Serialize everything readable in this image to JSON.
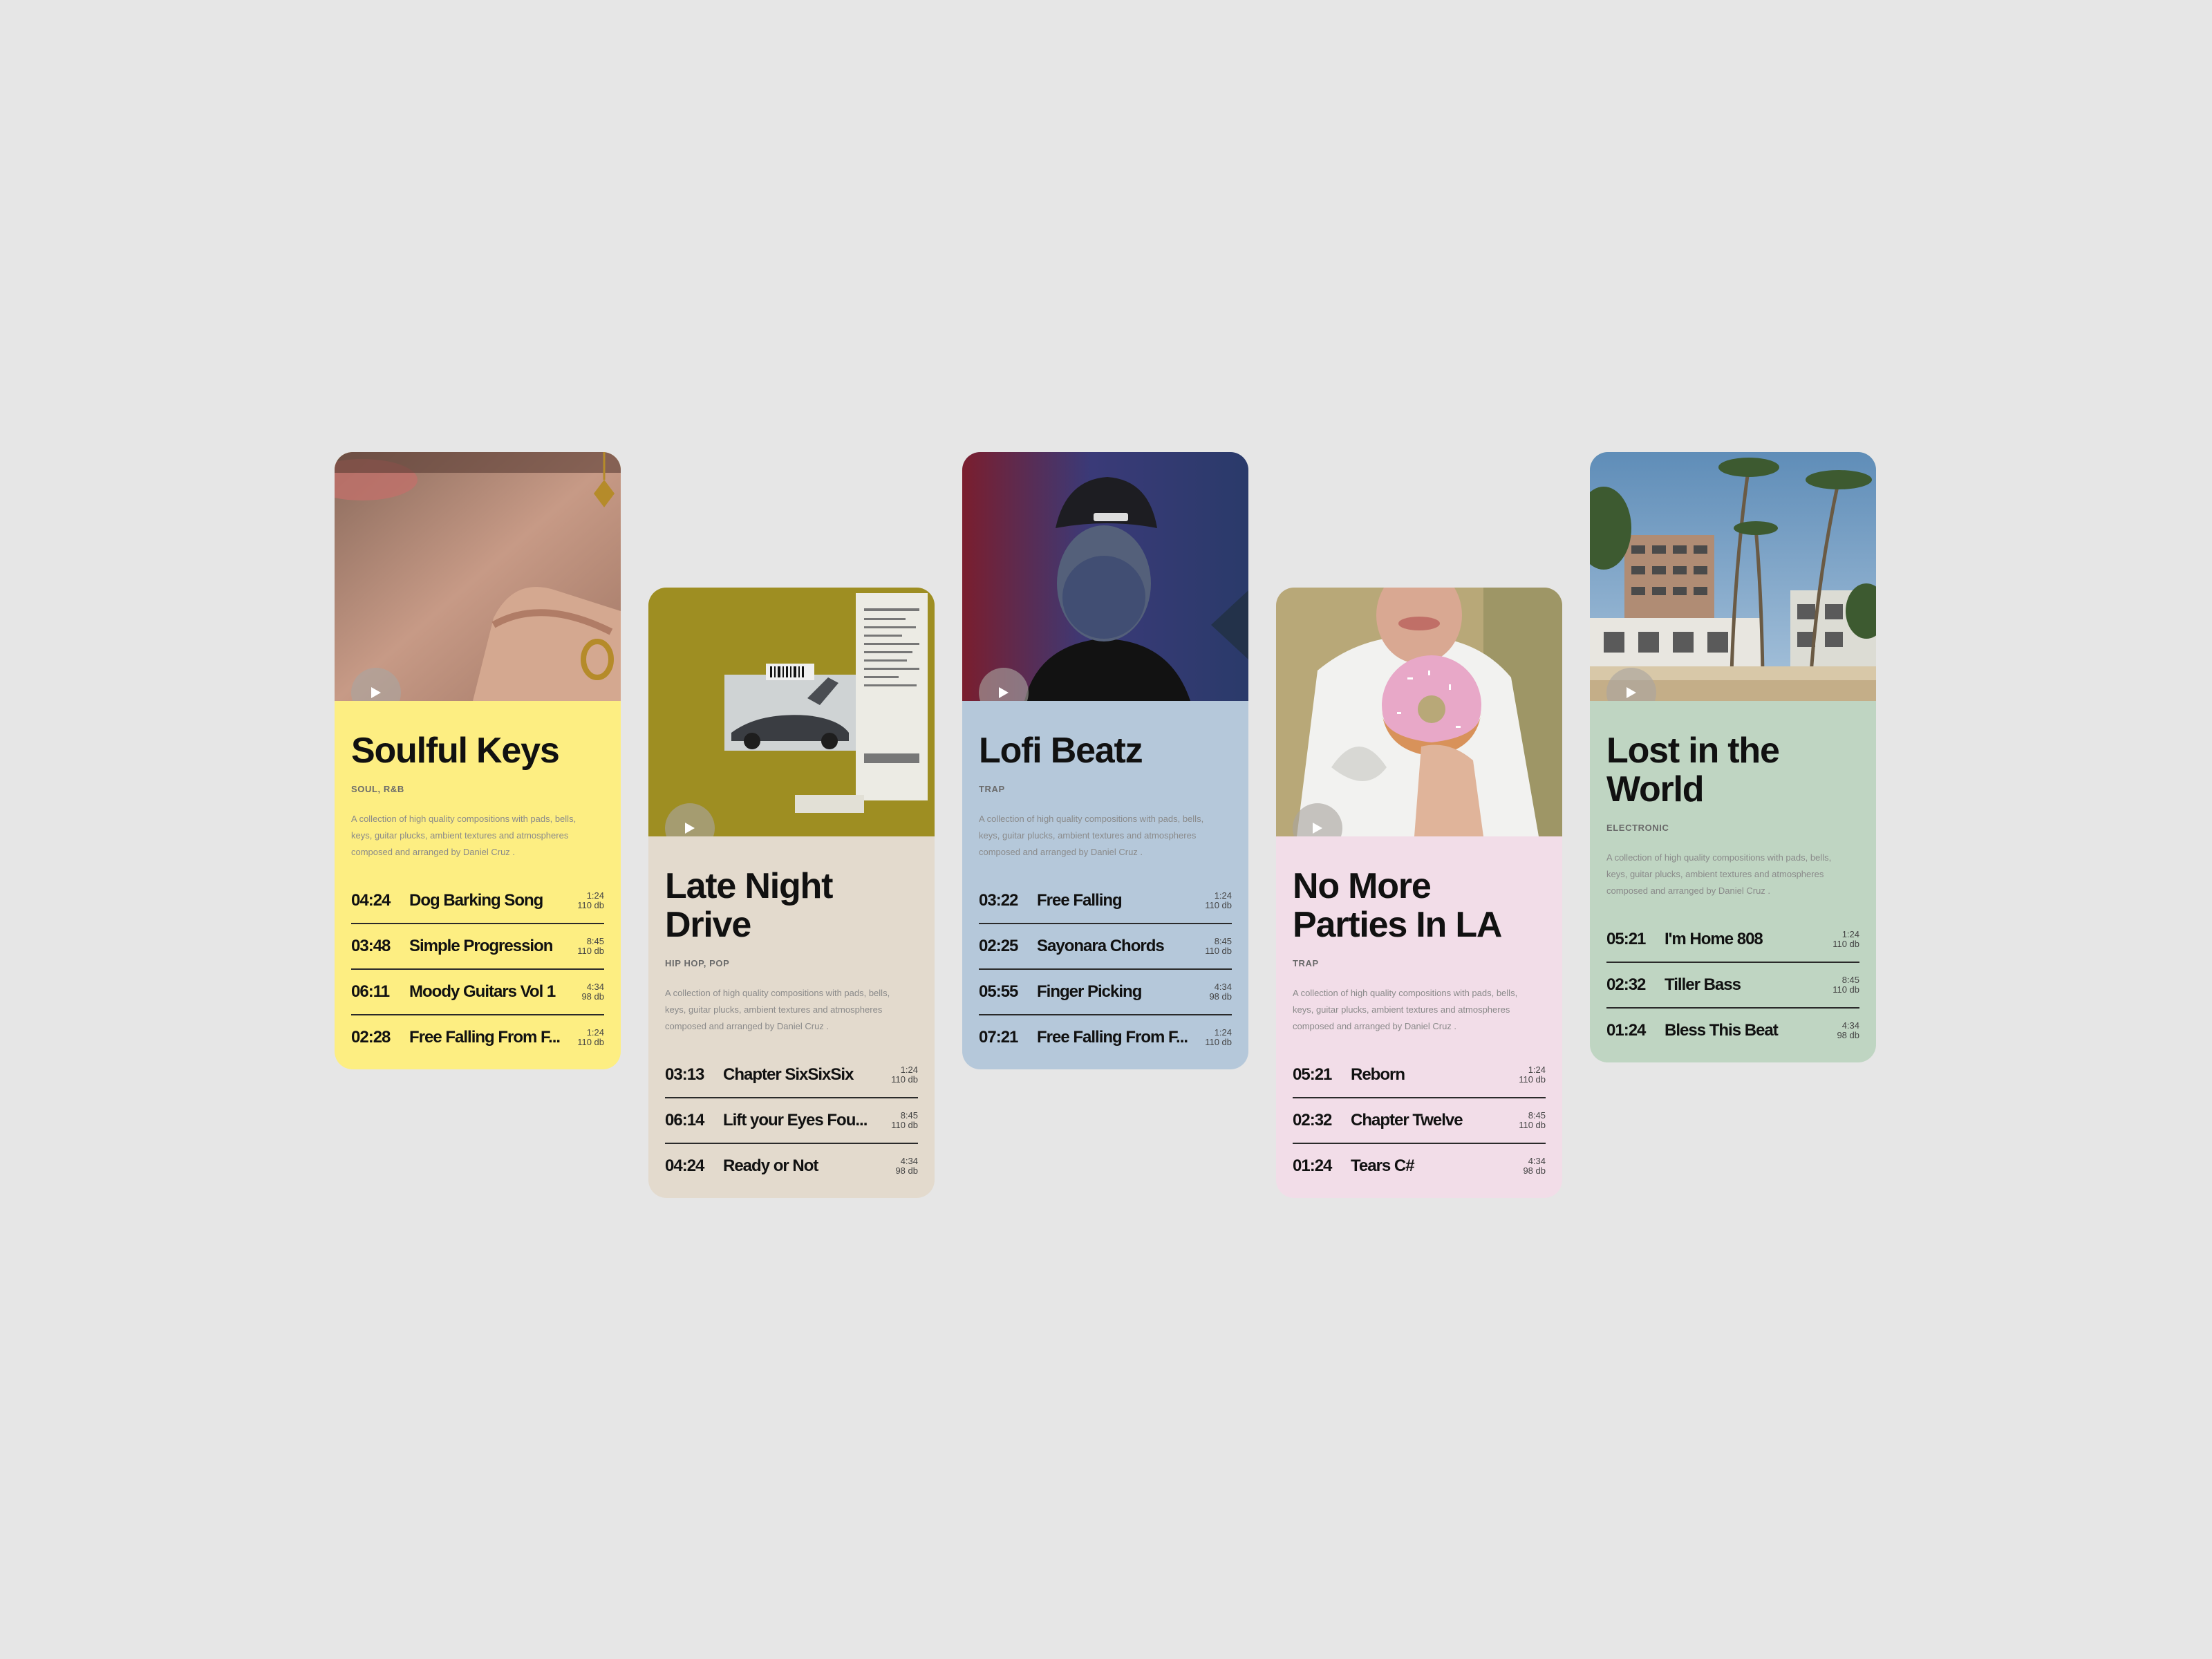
{
  "description_label": "A collection of high quality compositions with pads, bells, keys, guitar plucks, ambient textures and atmospheres composed and arranged by Daniel Cruz",
  "cards": [
    {
      "title": "Soulful Keys",
      "genre": "SOUL, R&B",
      "description": "A collection of high quality compositions with pads, bells, keys, guitar plucks, ambient textures and atmospheres composed and arranged by Daniel Cruz .",
      "color": "#fdee82",
      "tracks": [
        {
          "time": "04:24",
          "name": "Dog Barking Song",
          "dur": "1:24",
          "db": "110 db"
        },
        {
          "time": "03:48",
          "name": "Simple Progression",
          "dur": "8:45",
          "db": "110 db"
        },
        {
          "time": "06:11",
          "name": "Moody Guitars Vol 1",
          "dur": "4:34",
          "db": "98 db"
        },
        {
          "time": "02:28",
          "name": "Free Falling From F...",
          "dur": "1:24",
          "db": "110 db"
        }
      ]
    },
    {
      "title": "Late Night Drive",
      "genre": "HIP HOP, POP",
      "description": "A collection of high quality compositions with pads, bells, keys, guitar plucks, ambient textures and atmospheres composed and arranged by Daniel Cruz .",
      "color": "#e3dacd",
      "tracks": [
        {
          "time": "03:13",
          "name": "Chapter SixSixSix",
          "dur": "1:24",
          "db": "110 db"
        },
        {
          "time": "06:14",
          "name": "Lift your Eyes Fou...",
          "dur": "8:45",
          "db": "110 db"
        },
        {
          "time": "04:24",
          "name": "Ready or Not",
          "dur": "4:34",
          "db": "98 db"
        }
      ]
    },
    {
      "title": "Lofi Beatz",
      "genre": "TRAP",
      "description": "A collection of high quality compositions with pads, bells, keys, guitar plucks, ambient textures and atmospheres composed and arranged by Daniel Cruz .",
      "color": "#b5c8da",
      "tracks": [
        {
          "time": "03:22",
          "name": "Free Falling",
          "dur": "1:24",
          "db": "110 db"
        },
        {
          "time": "02:25",
          "name": "Sayonara Chords",
          "dur": "8:45",
          "db": "110 db"
        },
        {
          "time": "05:55",
          "name": "Finger Picking",
          "dur": "4:34",
          "db": "98 db"
        },
        {
          "time": "07:21",
          "name": "Free Falling From F...",
          "dur": "1:24",
          "db": "110 db"
        }
      ]
    },
    {
      "title": "No More Parties In LA",
      "genre": "TRAP",
      "description": "A collection of high quality compositions with pads, bells, keys, guitar plucks, ambient textures and atmospheres composed and arranged by Daniel Cruz .",
      "color": "#f2dde8",
      "tracks": [
        {
          "time": "05:21",
          "name": "Reborn",
          "dur": "1:24",
          "db": "110 db"
        },
        {
          "time": "02:32",
          "name": "Chapter Twelve",
          "dur": "8:45",
          "db": "110 db"
        },
        {
          "time": "01:24",
          "name": "Tears C#",
          "dur": "4:34",
          "db": "98 db"
        }
      ]
    },
    {
      "title": "Lost in the World",
      "genre": "ELECTRONIC",
      "description": "A collection of high quality compositions with pads, bells, keys, guitar plucks, ambient textures and atmospheres composed and arranged by Daniel Cruz .",
      "color": "#bfd5c2",
      "tracks": [
        {
          "time": "05:21",
          "name": "I'm Home 808",
          "dur": "1:24",
          "db": "110 db"
        },
        {
          "time": "02:32",
          "name": "Tiller Bass",
          "dur": "8:45",
          "db": "110 db"
        },
        {
          "time": "01:24",
          "name": "Bless This Beat",
          "dur": "4:34",
          "db": "98 db"
        }
      ]
    }
  ]
}
